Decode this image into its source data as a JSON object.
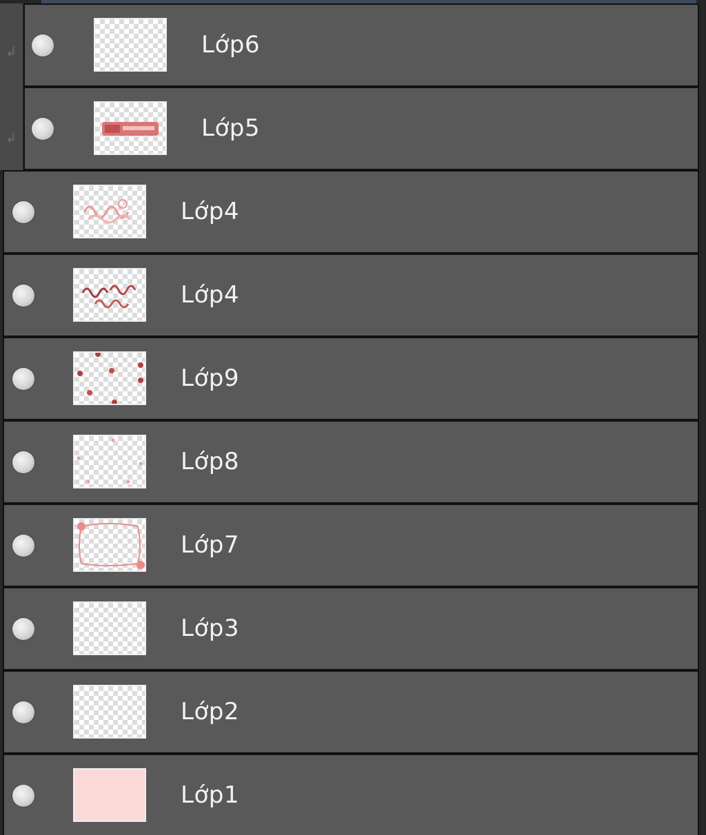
{
  "layers": [
    {
      "name": "Lớp6",
      "clipped": true,
      "visible": true,
      "thumb": "transparent"
    },
    {
      "name": "Lớp5",
      "clipped": true,
      "visible": true,
      "thumb": "red-banner"
    },
    {
      "name": "Lớp4",
      "clipped": false,
      "visible": true,
      "thumb": "pink-script"
    },
    {
      "name": "Lớp4",
      "clipped": false,
      "visible": true,
      "thumb": "dark-script"
    },
    {
      "name": "Lớp9",
      "clipped": false,
      "visible": true,
      "thumb": "red-dots"
    },
    {
      "name": "Lớp8",
      "clipped": false,
      "visible": true,
      "thumb": "faint-dots"
    },
    {
      "name": "Lớp7",
      "clipped": false,
      "visible": true,
      "thumb": "pink-frame"
    },
    {
      "name": "Lớp3",
      "clipped": false,
      "visible": true,
      "thumb": "transparent"
    },
    {
      "name": "Lớp2",
      "clipped": false,
      "visible": true,
      "thumb": "transparent"
    },
    {
      "name": "Lớp1",
      "clipped": false,
      "visible": true,
      "thumb": "solid-pink"
    }
  ],
  "colors": {
    "row_bg": "#595959",
    "thumb_fill_pink": "#fbd9d6",
    "accent_red": "#c85a5a"
  },
  "icons": {
    "visibility": "eye-icon",
    "clipping": "clip-arrow-icon"
  }
}
